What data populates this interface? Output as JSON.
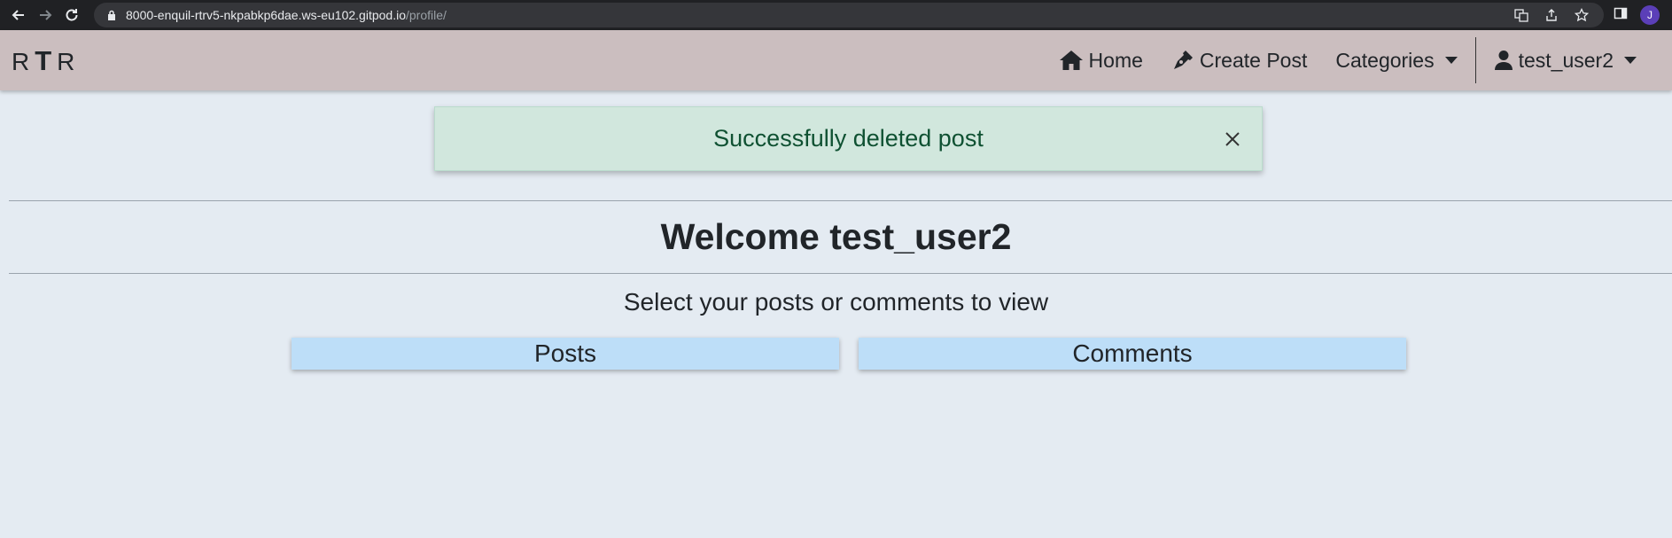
{
  "browser": {
    "url_host": "8000-enquil-rtrv5-nkpabkp6dae.ws-eu102.gitpod.io",
    "url_path": "/profile/",
    "profile_initial": "J"
  },
  "navbar": {
    "brand_left": "R",
    "brand_mid": "T",
    "brand_right": "R",
    "home": "Home",
    "create_post": "Create Post",
    "categories": "Categories",
    "user": "test_user2"
  },
  "alert": {
    "message": "Successfully deleted post"
  },
  "main": {
    "welcome": "Welcome test_user2",
    "subtitle": "Select your posts or comments to view",
    "posts_button": "Posts",
    "comments_button": "Comments"
  },
  "colors": {
    "navbar_bg": "#cbbebf",
    "page_bg": "#e4ebf2",
    "alert_bg": "#d1e7dd",
    "alert_text": "#0f5132",
    "select_button_bg": "#bddef8"
  }
}
